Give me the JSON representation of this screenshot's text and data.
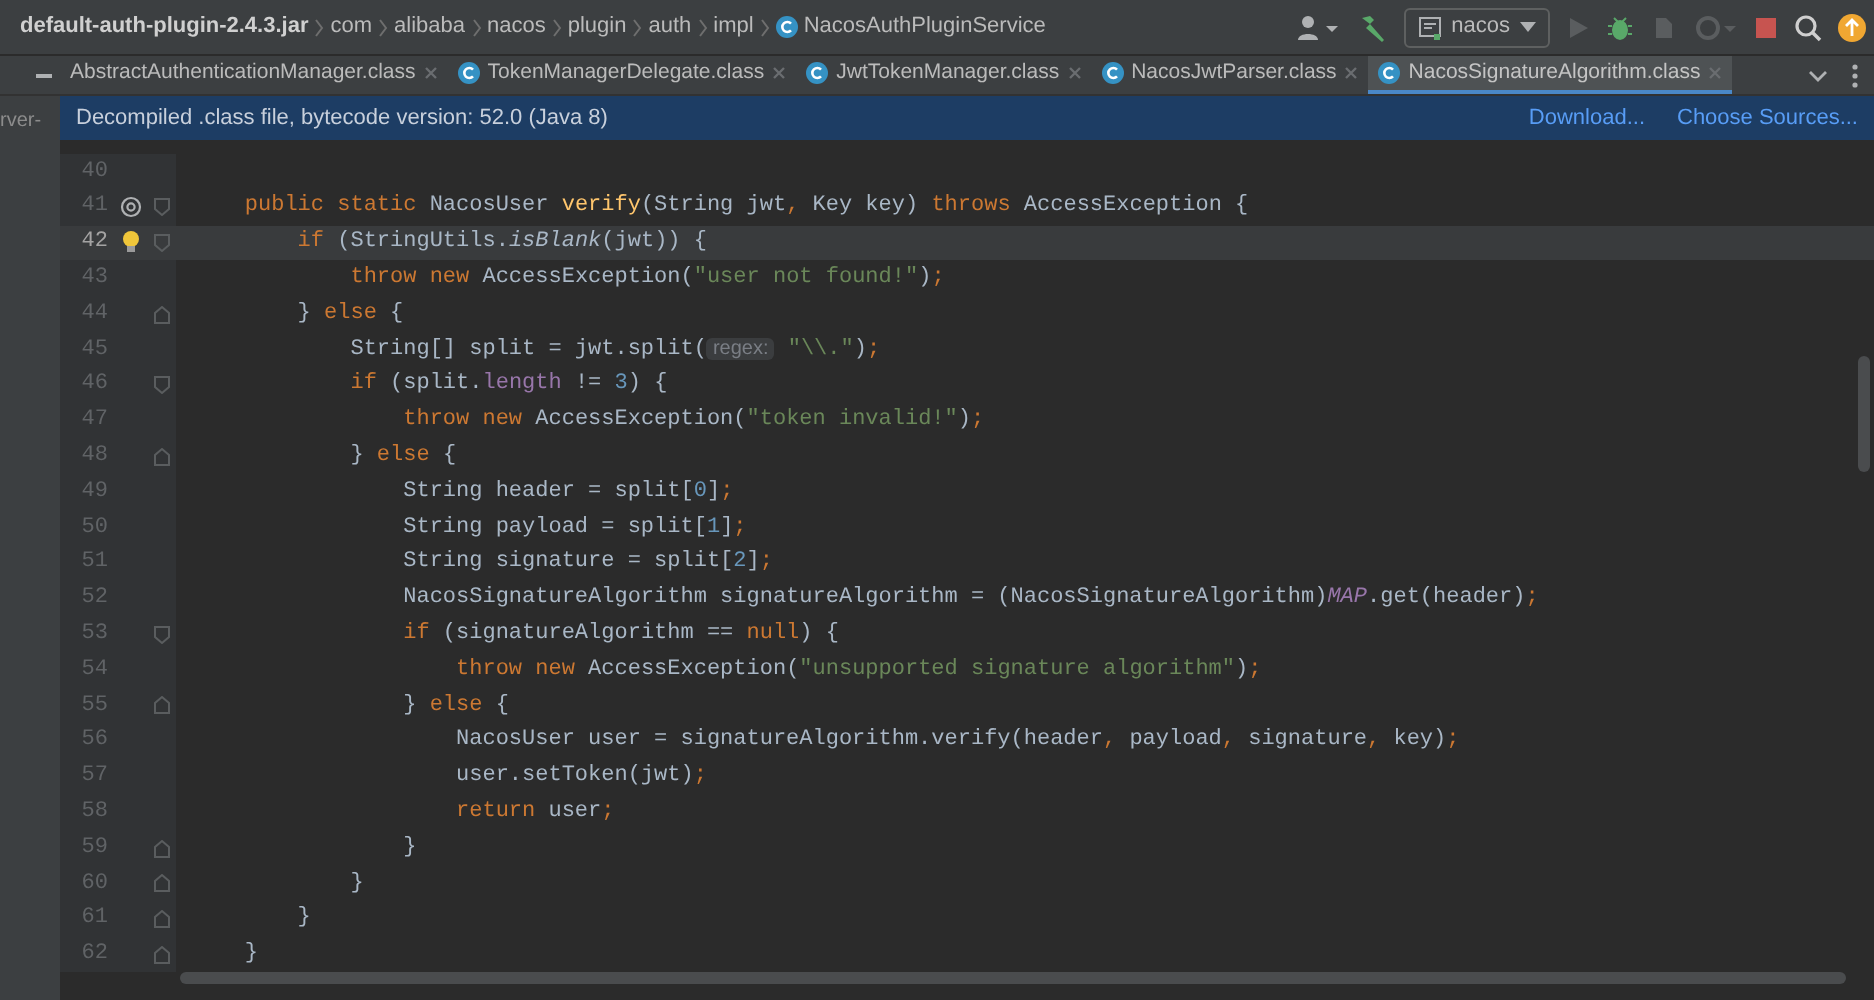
{
  "breadcrumbs": [
    {
      "label": "default-auth-plugin-2.4.3.jar",
      "kind": "archive"
    },
    {
      "label": "com",
      "kind": "package"
    },
    {
      "label": "alibaba",
      "kind": "package"
    },
    {
      "label": "nacos",
      "kind": "package"
    },
    {
      "label": "plugin",
      "kind": "package"
    },
    {
      "label": "auth",
      "kind": "package"
    },
    {
      "label": "impl",
      "kind": "package"
    },
    {
      "label": "NacosAuthPluginService",
      "kind": "class"
    }
  ],
  "run_configuration": {
    "label": "nacos"
  },
  "project_panel": {
    "label": "rver-"
  },
  "tabs": [
    {
      "label": "AbstractAuthenticationManager.class",
      "kind": "plain",
      "selected": false
    },
    {
      "label": "TokenManagerDelegate.class",
      "kind": "class",
      "selected": false
    },
    {
      "label": "JwtTokenManager.class",
      "kind": "class",
      "selected": false
    },
    {
      "label": "NacosJwtParser.class",
      "kind": "class",
      "selected": false
    },
    {
      "label": "NacosSignatureAlgorithm.class",
      "kind": "class",
      "selected": true
    }
  ],
  "banner": {
    "message": "Decompiled .class file, bytecode version: 52.0 (Java 8)",
    "links": [
      "Download...",
      "Choose Sources..."
    ]
  },
  "code_lines": [
    {
      "number": "40",
      "current": false
    },
    {
      "number": "41",
      "current": false,
      "override": true,
      "fold_open": true,
      "tokens": [
        {
          "kind": "keyword",
          "text": "    public static "
        },
        {
          "kind": "plain",
          "text": "NacosUser "
        },
        {
          "kind": "method",
          "text": "verify"
        },
        {
          "kind": "plain",
          "text": "(String jwt"
        },
        {
          "kind": "punct",
          "text": ", "
        },
        {
          "kind": "plain",
          "text": "Key key) "
        },
        {
          "kind": "keyword",
          "text": "throws "
        },
        {
          "kind": "plain",
          "text": "AccessException {"
        }
      ]
    },
    {
      "number": "42",
      "current": true,
      "intention_bulb": true,
      "fold_open": true,
      "tokens": [
        {
          "kind": "keyword",
          "text": "        if "
        },
        {
          "kind": "plain",
          "text": "(StringUtils."
        },
        {
          "kind": "static",
          "text": "isBlank"
        },
        {
          "kind": "plain",
          "text": "(jwt)) {"
        }
      ]
    },
    {
      "number": "43",
      "current": false,
      "tokens": [
        {
          "kind": "keyword",
          "text": "            throw new "
        },
        {
          "kind": "plain",
          "text": "AccessException("
        },
        {
          "kind": "string",
          "text": "\"user not found!\""
        },
        {
          "kind": "plain",
          "text": ")"
        },
        {
          "kind": "punct",
          "text": ";"
        }
      ]
    },
    {
      "number": "44",
      "current": false,
      "fold_close": true,
      "tokens": [
        {
          "kind": "plain",
          "text": "        } "
        },
        {
          "kind": "keyword",
          "text": "else "
        },
        {
          "kind": "plain",
          "text": "{"
        }
      ]
    },
    {
      "number": "45",
      "current": false,
      "tokens": [
        {
          "kind": "plain",
          "text": "            String[] split = jwt.split("
        },
        {
          "kind": "hint",
          "text": "regex:"
        },
        {
          "kind": "string",
          "text": " \"\\\\.\""
        },
        {
          "kind": "plain",
          "text": ")"
        },
        {
          "kind": "punct",
          "text": ";"
        }
      ]
    },
    {
      "number": "46",
      "current": false,
      "fold_open": true,
      "tokens": [
        {
          "kind": "keyword",
          "text": "            if "
        },
        {
          "kind": "plain",
          "text": "(split."
        },
        {
          "kind": "field",
          "text": "length"
        },
        {
          "kind": "plain",
          "text": " != "
        },
        {
          "kind": "number",
          "text": "3"
        },
        {
          "kind": "plain",
          "text": ") {"
        }
      ]
    },
    {
      "number": "47",
      "current": false,
      "tokens": [
        {
          "kind": "keyword",
          "text": "                throw new "
        },
        {
          "kind": "plain",
          "text": "AccessException("
        },
        {
          "kind": "string",
          "text": "\"token invalid!\""
        },
        {
          "kind": "plain",
          "text": ")"
        },
        {
          "kind": "punct",
          "text": ";"
        }
      ]
    },
    {
      "number": "48",
      "current": false,
      "fold_close": true,
      "tokens": [
        {
          "kind": "plain",
          "text": "            } "
        },
        {
          "kind": "keyword",
          "text": "else "
        },
        {
          "kind": "plain",
          "text": "{"
        }
      ]
    },
    {
      "number": "49",
      "current": false,
      "tokens": [
        {
          "kind": "plain",
          "text": "                String header = split["
        },
        {
          "kind": "number",
          "text": "0"
        },
        {
          "kind": "plain",
          "text": "]"
        },
        {
          "kind": "punct",
          "text": ";"
        }
      ]
    },
    {
      "number": "50",
      "current": false,
      "tokens": [
        {
          "kind": "plain",
          "text": "                String payload = split["
        },
        {
          "kind": "number",
          "text": "1"
        },
        {
          "kind": "plain",
          "text": "]"
        },
        {
          "kind": "punct",
          "text": ";"
        }
      ]
    },
    {
      "number": "51",
      "current": false,
      "tokens": [
        {
          "kind": "plain",
          "text": "                String signature = split["
        },
        {
          "kind": "number",
          "text": "2"
        },
        {
          "kind": "plain",
          "text": "]"
        },
        {
          "kind": "punct",
          "text": ";"
        }
      ]
    },
    {
      "number": "52",
      "current": false,
      "tokens": [
        {
          "kind": "plain",
          "text": "                NacosSignatureAlgorithm signatureAlgorithm = (NacosSignatureAlgorithm)"
        },
        {
          "kind": "constant",
          "text": "MAP"
        },
        {
          "kind": "plain",
          "text": ".get(header)"
        },
        {
          "kind": "punct",
          "text": ";"
        }
      ]
    },
    {
      "number": "53",
      "current": false,
      "fold_open": true,
      "tokens": [
        {
          "kind": "keyword",
          "text": "                if "
        },
        {
          "kind": "plain",
          "text": "(signatureAlgorithm == "
        },
        {
          "kind": "keyword",
          "text": "null"
        },
        {
          "kind": "plain",
          "text": ") {"
        }
      ]
    },
    {
      "number": "54",
      "current": false,
      "tokens": [
        {
          "kind": "keyword",
          "text": "                    throw new "
        },
        {
          "kind": "plain",
          "text": "AccessException("
        },
        {
          "kind": "string",
          "text": "\"unsupported signature algorithm\""
        },
        {
          "kind": "plain",
          "text": ")"
        },
        {
          "kind": "punct",
          "text": ";"
        }
      ]
    },
    {
      "number": "55",
      "current": false,
      "fold_close": true,
      "tokens": [
        {
          "kind": "plain",
          "text": "                } "
        },
        {
          "kind": "keyword",
          "text": "else "
        },
        {
          "kind": "plain",
          "text": "{"
        }
      ]
    },
    {
      "number": "56",
      "current": false,
      "tokens": [
        {
          "kind": "plain",
          "text": "                    NacosUser user = signatureAlgorithm.verify(header"
        },
        {
          "kind": "punct",
          "text": ", "
        },
        {
          "kind": "plain",
          "text": "payload"
        },
        {
          "kind": "punct",
          "text": ", "
        },
        {
          "kind": "plain",
          "text": "signature"
        },
        {
          "kind": "punct",
          "text": ", "
        },
        {
          "kind": "plain",
          "text": "key)"
        },
        {
          "kind": "punct",
          "text": ";"
        }
      ]
    },
    {
      "number": "57",
      "current": false,
      "tokens": [
        {
          "kind": "plain",
          "text": "                    user.setToken(jwt)"
        },
        {
          "kind": "punct",
          "text": ";"
        }
      ]
    },
    {
      "number": "58",
      "current": false,
      "tokens": [
        {
          "kind": "keyword",
          "text": "                    return "
        },
        {
          "kind": "plain",
          "text": "user"
        },
        {
          "kind": "punct",
          "text": ";"
        }
      ]
    },
    {
      "number": "59",
      "current": false,
      "fold_close": true,
      "tokens": [
        {
          "kind": "plain",
          "text": "                }"
        }
      ]
    },
    {
      "number": "60",
      "current": false,
      "fold_close": true,
      "tokens": [
        {
          "kind": "plain",
          "text": "            }"
        }
      ]
    },
    {
      "number": "61",
      "current": false,
      "fold_close": true,
      "tokens": [
        {
          "kind": "plain",
          "text": "        }"
        }
      ]
    },
    {
      "number": "62",
      "current": false,
      "fold_close": true,
      "tokens": [
        {
          "kind": "plain",
          "text": "    }"
        }
      ]
    }
  ]
}
